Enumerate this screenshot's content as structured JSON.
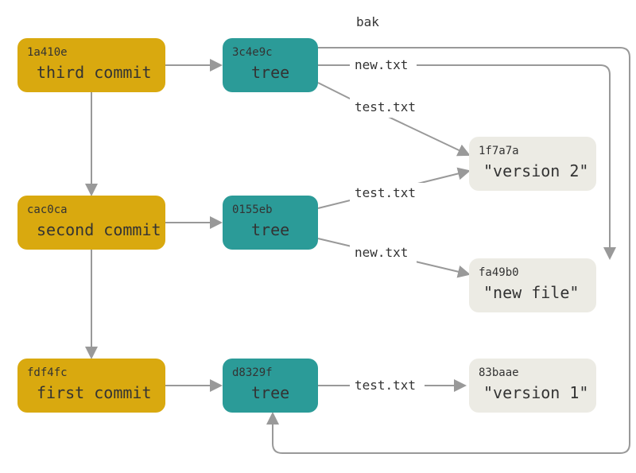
{
  "colors": {
    "commit": "#d9a90f",
    "tree": "#2b9b98",
    "blob": "#ecebe4",
    "arrow": "#999999"
  },
  "nodes": {
    "commit3": {
      "hash": "1a410e",
      "label": "third commit"
    },
    "commit2": {
      "hash": "cac0ca",
      "label": "second commit"
    },
    "commit1": {
      "hash": "fdf4fc",
      "label": "first commit"
    },
    "tree3": {
      "hash": "3c4e9c",
      "label": "tree"
    },
    "tree2": {
      "hash": "0155eb",
      "label": "tree"
    },
    "tree1": {
      "hash": "d8329f",
      "label": "tree"
    },
    "blobV2": {
      "hash": "1f7a7a",
      "label": "\"version 2\""
    },
    "blobNew": {
      "hash": "fa49b0",
      "label": "\"new file\""
    },
    "blobV1": {
      "hash": "83baae",
      "label": "\"version 1\""
    }
  },
  "edgeLabels": {
    "bak": "bak",
    "newtxt": "new.txt",
    "testtxt": "test.txt"
  }
}
